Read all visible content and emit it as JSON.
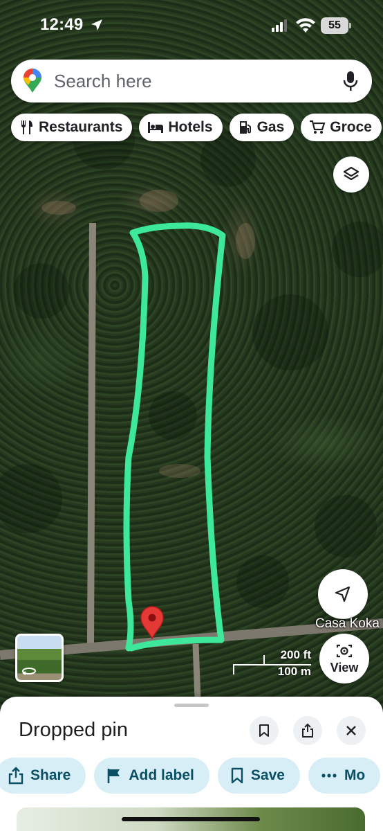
{
  "status_bar": {
    "time": "12:49",
    "battery": "55",
    "location_icon": "location-arrow-icon",
    "signal_icon": "cell-signal-icon",
    "wifi_icon": "wifi-icon"
  },
  "search": {
    "placeholder": "Search here",
    "logo_icon": "maps-pin-logo",
    "mic_icon": "mic-icon"
  },
  "chips": [
    {
      "label": "Restaurants",
      "icon": "restaurant-icon"
    },
    {
      "label": "Hotels",
      "icon": "hotel-bed-icon"
    },
    {
      "label": "Gas",
      "icon": "gas-station-icon"
    },
    {
      "label": "Groce",
      "icon": "cart-icon"
    }
  ],
  "map": {
    "place_label": "Casa Koka",
    "scale_ft": "200 ft",
    "scale_m": "100 m",
    "view_label": "View",
    "outline_color": "#3ee89b",
    "pin_color": "#e53935"
  },
  "sheet": {
    "title": "Dropped pin",
    "actions": [
      {
        "label": "Share",
        "icon": "share-icon"
      },
      {
        "label": "Add label",
        "icon": "flag-icon"
      },
      {
        "label": "Save",
        "icon": "bookmark-icon"
      },
      {
        "label": "Mo",
        "icon": "more-dots-icon"
      }
    ]
  }
}
